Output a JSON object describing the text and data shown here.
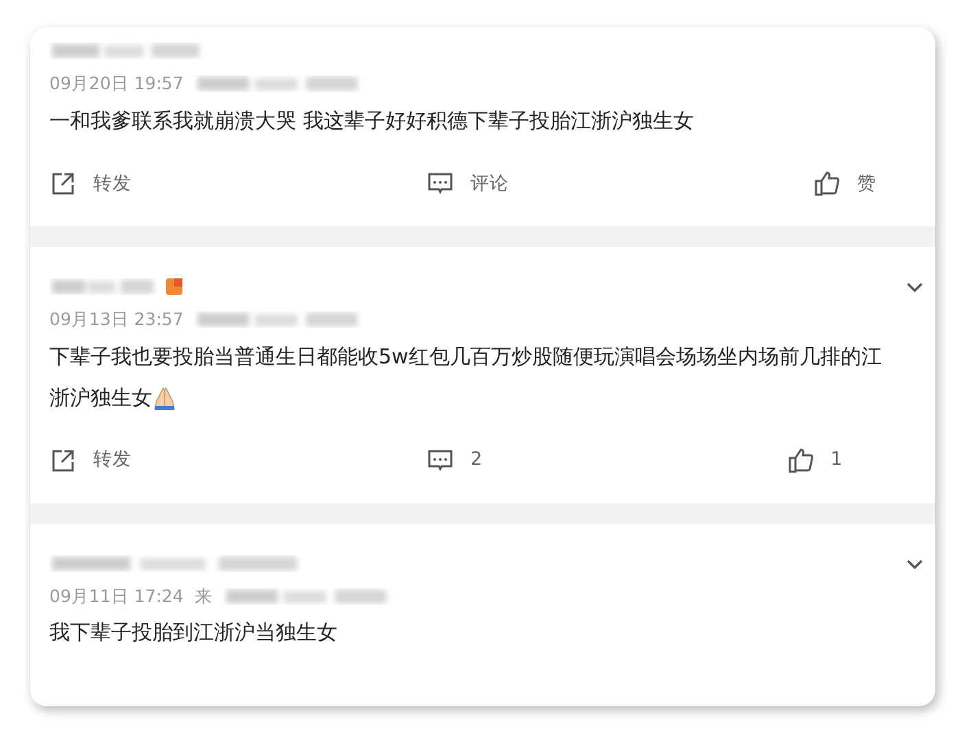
{
  "comments": [
    {
      "menu": false,
      "badge": false,
      "date": "09月20日 19:57",
      "text": "一和我爹联系我就崩溃大哭 我这辈子好好积德下辈子投胎江浙沪独生女",
      "emoji": false,
      "actions": [
        {
          "kind": "repost",
          "label": "转发"
        },
        {
          "kind": "comment",
          "label": "评论"
        },
        {
          "kind": "like",
          "label": "赞"
        }
      ]
    },
    {
      "menu": true,
      "badge": true,
      "date": "09月13日 23:57",
      "text": "下辈子我也要投胎当普通生日都能收5w红包几百万炒股随便玩演唱会场场坐内场前几排的江浙沪独生女",
      "emoji": true,
      "actions": [
        {
          "kind": "repost",
          "label": "转发"
        },
        {
          "kind": "comment",
          "label": "2"
        },
        {
          "kind": "like",
          "label": "1"
        }
      ]
    },
    {
      "menu": true,
      "badge": false,
      "date": "09月11日 17:24",
      "source": "来",
      "text": "我下辈子投胎到江浙沪当独生女",
      "emoji": false
    }
  ]
}
